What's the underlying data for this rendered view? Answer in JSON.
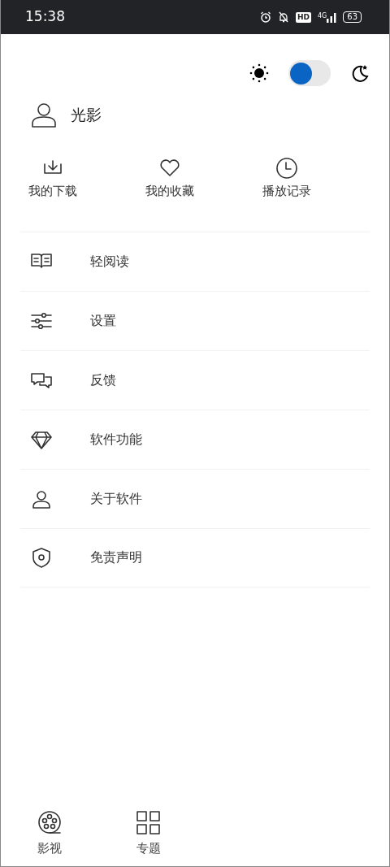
{
  "status_bar": {
    "time": "15:38",
    "hd": "HD",
    "network": "4G",
    "battery": "63"
  },
  "theme_switch": {
    "dark": false
  },
  "profile": {
    "name": "光影"
  },
  "shortcuts": [
    {
      "label": "我的下载"
    },
    {
      "label": "我的收藏"
    },
    {
      "label": "播放记录"
    }
  ],
  "menu": [
    {
      "label": "轻阅读"
    },
    {
      "label": "设置"
    },
    {
      "label": "反馈"
    },
    {
      "label": "软件功能"
    },
    {
      "label": "关于软件"
    },
    {
      "label": "免责声明"
    }
  ],
  "bottom_nav": [
    {
      "label": "影视",
      "selected": false
    },
    {
      "label": "专题",
      "selected": false
    }
  ]
}
